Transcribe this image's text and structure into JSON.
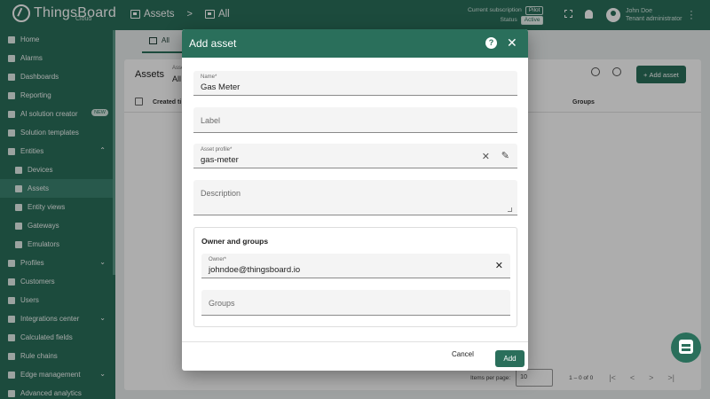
{
  "app": {
    "name": "ThingsBoard",
    "edition": "Cloud"
  },
  "breadcrumb": {
    "section": "Assets",
    "separator": ">",
    "current": "All"
  },
  "subscription": {
    "label": "Current subscription",
    "plan": "Pilot",
    "status_label": "Status",
    "status": "Active"
  },
  "user": {
    "name": "John Doe",
    "role": "Tenant administrator"
  },
  "sidebar": {
    "items": [
      {
        "label": "Home",
        "icon": "home-icon"
      },
      {
        "label": "Alarms",
        "icon": "alarm-icon"
      },
      {
        "label": "Dashboards",
        "icon": "dashboard-icon"
      },
      {
        "label": "Reporting",
        "icon": "report-icon"
      },
      {
        "label": "AI solution creator",
        "icon": "sparkle-icon",
        "badge": "NEW"
      },
      {
        "label": "Solution templates",
        "icon": "template-icon"
      },
      {
        "label": "Entities",
        "icon": "entities-icon",
        "chevron": "^"
      },
      {
        "label": "Devices",
        "icon": "devices-icon"
      },
      {
        "label": "Assets",
        "icon": "assets-icon"
      },
      {
        "label": "Entity views",
        "icon": "entity-views-icon"
      },
      {
        "label": "Gateways",
        "icon": "gateway-icon"
      },
      {
        "label": "Emulators",
        "icon": "emulator-icon"
      },
      {
        "label": "Profiles",
        "icon": "profiles-icon",
        "chevron": "v"
      },
      {
        "label": "Customers",
        "icon": "customers-icon"
      },
      {
        "label": "Users",
        "icon": "users-icon"
      },
      {
        "label": "Integrations center",
        "icon": "integrations-icon",
        "chevron": "v"
      },
      {
        "label": "Calculated fields",
        "icon": "function-icon"
      },
      {
        "label": "Rule chains",
        "icon": "rule-chain-icon"
      },
      {
        "label": "Edge management",
        "icon": "edge-icon",
        "chevron": "v"
      },
      {
        "label": "Advanced analytics",
        "icon": "analytics-icon"
      }
    ]
  },
  "tabs": {
    "all_label": "All"
  },
  "card": {
    "title": "Assets",
    "filter_label": "Asse",
    "filter_value": "All",
    "add_label": "Add asset",
    "columns": [
      "Created ti",
      "Groups"
    ],
    "pager_label": "Items per page:",
    "page_size": "10",
    "range": "1 – 0 of 0"
  },
  "dialog": {
    "title": "Add asset",
    "name_label": "Name*",
    "name_value": "Gas Meter",
    "label_placeholder": "Label",
    "profile_label": "Asset profile*",
    "profile_value": "gas-meter",
    "description_placeholder": "Description",
    "owner_section_title": "Owner and groups",
    "owner_label": "Owner*",
    "owner_value": "johndoe@thingsboard.io",
    "groups_placeholder": "Groups",
    "cancel_label": "Cancel",
    "add_label": "Add"
  },
  "colors": {
    "brand": "#2a6f5b",
    "sidebar_selected": "#3c8371"
  }
}
